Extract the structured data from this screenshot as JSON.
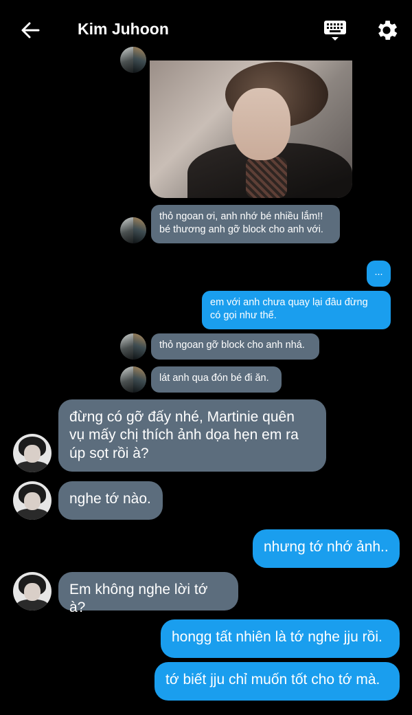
{
  "header": {
    "title": "Kim Juhoon",
    "back_icon": "arrow-left-icon",
    "keyboard_icon": "keyboard-icon",
    "settings_icon": "gear-icon"
  },
  "colors": {
    "background": "#000000",
    "incoming_bubble": "#5c6d7d",
    "outgoing_bubble": "#1a9eee",
    "text": "#ffffff"
  },
  "messages": [
    {
      "side": "incoming",
      "type": "image"
    },
    {
      "side": "incoming",
      "text": "thỏ ngoan ơi, anh nhớ bé nhiều lắm!!\nbé thương anh gỡ block cho anh với."
    },
    {
      "side": "outgoing",
      "text": "..."
    },
    {
      "side": "outgoing",
      "text": "em với anh chưa quay lại đâu đừng\ncó gọi như thế."
    },
    {
      "side": "incoming",
      "text": "thỏ ngoan gỡ block cho anh nhá."
    },
    {
      "side": "incoming",
      "text": "lát anh qua đón bé đi ăn."
    },
    {
      "side": "incoming",
      "text": "đừng có gỡ đấy nhé, Martinie quên\nvụ mấy chị thích ảnh dọa hẹn em ra\núp sọt rồi à?"
    },
    {
      "side": "incoming",
      "text": "nghe tớ nào."
    },
    {
      "side": "outgoing",
      "text": "nhưng tớ nhớ ảnh.."
    },
    {
      "side": "incoming",
      "text": "Em không nghe lời tớ à?"
    },
    {
      "side": "outgoing",
      "text": "hongg tất nhiên là tớ nghe jju rồi."
    },
    {
      "side": "outgoing",
      "text": "tớ biết jju chỉ muốn tốt cho tớ mà."
    }
  ]
}
